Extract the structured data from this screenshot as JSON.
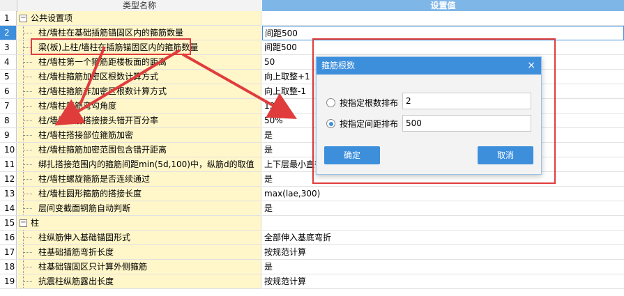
{
  "header": {
    "col_name": "类型名称",
    "col_value": "设置值"
  },
  "rows": [
    {
      "num": "1",
      "label": "公共设置项",
      "value": "",
      "group": true,
      "expander": "−"
    },
    {
      "num": "2",
      "label": "柱/墙柱在基础插筋锚固区内的箍筋数量",
      "value": "间距500"
    },
    {
      "num": "3",
      "label": "梁(板)上柱/墙柱在插筋锚固区内的箍筋数量",
      "value": "间距500"
    },
    {
      "num": "4",
      "label": "柱/墙柱第一个箍筋距楼板面的距离",
      "value": "50"
    },
    {
      "num": "5",
      "label": "柱/墙柱箍筋加密区根数计算方式",
      "value": "向上取整+1"
    },
    {
      "num": "6",
      "label": "柱/墙柱箍筋非加密区根数计算方式",
      "value": "向上取整-1"
    },
    {
      "num": "7",
      "label": "柱/墙柱箍筋弯勾角度",
      "value": "135°"
    },
    {
      "num": "8",
      "label": "柱/墙柱纵筋搭接接头错开百分率",
      "value": "50%"
    },
    {
      "num": "9",
      "label": "柱/墙柱搭接部位箍筋加密",
      "value": "是"
    },
    {
      "num": "10",
      "label": "柱/墙柱箍筋加密范围包含错开距离",
      "value": "是"
    },
    {
      "num": "11",
      "label": "绑扎搭接范围内的箍筋间距min(5d,100)中，纵筋d的取值",
      "value": "上下层最小直径"
    },
    {
      "num": "12",
      "label": "柱/墙柱螺旋箍筋是否连续通过",
      "value": "是"
    },
    {
      "num": "13",
      "label": "柱/墙柱圆形箍筋的搭接长度",
      "value": "max(lae,300)"
    },
    {
      "num": "14",
      "label": "层间变截面钢筋自动判断",
      "value": "是"
    },
    {
      "num": "15",
      "label": "柱",
      "value": "",
      "group": true,
      "expander": "−"
    },
    {
      "num": "16",
      "label": "柱纵筋伸入基础锚固形式",
      "value": "全部伸入基底弯折"
    },
    {
      "num": "17",
      "label": "柱基础插筋弯折长度",
      "value": "按规范计算"
    },
    {
      "num": "18",
      "label": "柱基础锚固区只计算外侧箍筋",
      "value": "是"
    },
    {
      "num": "19",
      "label": "抗震柱纵筋露出长度",
      "value": "按规范计算"
    }
  ],
  "dialog": {
    "title": "箍筋根数",
    "close": "×",
    "option1_label": "按指定根数排布",
    "option1_value": "2",
    "option2_label": "按指定间距排布",
    "option2_value": "500",
    "selected_option": 2,
    "ok_label": "确定",
    "cancel_label": "取消"
  },
  "colors": {
    "accent": "#3d8fdc",
    "highlight_red": "#e03c3c",
    "name_cell_bg": "#fff6c9"
  }
}
